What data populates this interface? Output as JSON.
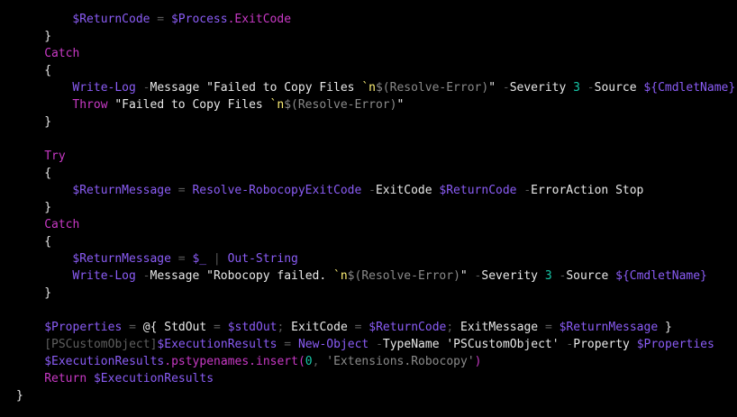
{
  "colors": {
    "background": "#000000",
    "default": "#e8e8e8",
    "variable": "#8a5cf5",
    "keyword": "#c839c5",
    "cmdlet": "#8a5cf5",
    "operator": "#5a5a5a",
    "string": "#e8e8e8",
    "number": "#16c7a8",
    "escape": "#fff176",
    "subexpr": "#8a8a8a",
    "type": "#5f5f5f",
    "member": "#c839c5"
  },
  "lines": [
    {
      "indent": 8,
      "tokens": [
        {
          "t": "var",
          "v": "$ReturnCode"
        },
        {
          "t": "op",
          "v": " = "
        },
        {
          "t": "var",
          "v": "$Process"
        },
        {
          "t": "member",
          "v": ".ExitCode"
        }
      ]
    },
    {
      "indent": 4,
      "tokens": [
        {
          "t": "plain",
          "v": "}"
        }
      ]
    },
    {
      "indent": 4,
      "tokens": [
        {
          "t": "kw",
          "v": "Catch"
        }
      ]
    },
    {
      "indent": 4,
      "tokens": [
        {
          "t": "plain",
          "v": "{"
        }
      ]
    },
    {
      "indent": 8,
      "tokens": [
        {
          "t": "cmd",
          "v": "Write-Log"
        },
        {
          "t": "op",
          "v": " -"
        },
        {
          "t": "plain",
          "v": "Message "
        },
        {
          "t": "str",
          "v": "\"Failed to Copy Files "
        },
        {
          "t": "esc",
          "v": "`n"
        },
        {
          "t": "sub",
          "v": "$(Resolve-Error)"
        },
        {
          "t": "str",
          "v": "\""
        },
        {
          "t": "op",
          "v": " -"
        },
        {
          "t": "plain",
          "v": "Severity "
        },
        {
          "t": "num",
          "v": "3"
        },
        {
          "t": "op",
          "v": " -"
        },
        {
          "t": "plain",
          "v": "Source "
        },
        {
          "t": "var",
          "v": "${CmdletName}"
        }
      ]
    },
    {
      "indent": 8,
      "tokens": [
        {
          "t": "kw",
          "v": "Throw"
        },
        {
          "t": "plain",
          "v": " "
        },
        {
          "t": "str",
          "v": "\"Failed to Copy Files "
        },
        {
          "t": "esc",
          "v": "`n"
        },
        {
          "t": "sub",
          "v": "$(Resolve-Error)"
        },
        {
          "t": "str",
          "v": "\""
        }
      ]
    },
    {
      "indent": 4,
      "tokens": [
        {
          "t": "plain",
          "v": "}"
        }
      ]
    },
    {
      "indent": 0,
      "tokens": []
    },
    {
      "indent": 4,
      "tokens": [
        {
          "t": "kw",
          "v": "Try"
        }
      ]
    },
    {
      "indent": 4,
      "tokens": [
        {
          "t": "plain",
          "v": "{"
        }
      ]
    },
    {
      "indent": 8,
      "tokens": [
        {
          "t": "var",
          "v": "$ReturnMessage"
        },
        {
          "t": "op",
          "v": " = "
        },
        {
          "t": "cmd",
          "v": "Resolve-RobocopyExitCode"
        },
        {
          "t": "op",
          "v": " -"
        },
        {
          "t": "plain",
          "v": "ExitCode "
        },
        {
          "t": "var",
          "v": "$ReturnCode"
        },
        {
          "t": "op",
          "v": " -"
        },
        {
          "t": "plain",
          "v": "ErrorAction Stop"
        }
      ]
    },
    {
      "indent": 4,
      "tokens": [
        {
          "t": "plain",
          "v": "}"
        }
      ]
    },
    {
      "indent": 4,
      "tokens": [
        {
          "t": "kw",
          "v": "Catch"
        }
      ]
    },
    {
      "indent": 4,
      "tokens": [
        {
          "t": "plain",
          "v": "{"
        }
      ]
    },
    {
      "indent": 8,
      "tokens": [
        {
          "t": "var",
          "v": "$ReturnMessage"
        },
        {
          "t": "op",
          "v": " = "
        },
        {
          "t": "var",
          "v": "$_"
        },
        {
          "t": "op",
          "v": " | "
        },
        {
          "t": "cmd",
          "v": "Out-String"
        }
      ]
    },
    {
      "indent": 8,
      "tokens": [
        {
          "t": "cmd",
          "v": "Write-Log"
        },
        {
          "t": "op",
          "v": " -"
        },
        {
          "t": "plain",
          "v": "Message "
        },
        {
          "t": "str",
          "v": "\"Robocopy failed. "
        },
        {
          "t": "esc",
          "v": "`n"
        },
        {
          "t": "sub",
          "v": "$(Resolve-Error)"
        },
        {
          "t": "str",
          "v": "\""
        },
        {
          "t": "op",
          "v": " -"
        },
        {
          "t": "plain",
          "v": "Severity "
        },
        {
          "t": "num",
          "v": "3"
        },
        {
          "t": "op",
          "v": " -"
        },
        {
          "t": "plain",
          "v": "Source "
        },
        {
          "t": "var",
          "v": "${CmdletName}"
        }
      ]
    },
    {
      "indent": 4,
      "tokens": [
        {
          "t": "plain",
          "v": "}"
        }
      ]
    },
    {
      "indent": 0,
      "tokens": []
    },
    {
      "indent": 4,
      "tokens": [
        {
          "t": "var",
          "v": "$Properties"
        },
        {
          "t": "op",
          "v": " = "
        },
        {
          "t": "plain",
          "v": "@{ StdOut "
        },
        {
          "t": "op",
          "v": "= "
        },
        {
          "t": "var",
          "v": "$stdOut"
        },
        {
          "t": "op",
          "v": "; "
        },
        {
          "t": "plain",
          "v": "ExitCode "
        },
        {
          "t": "op",
          "v": "= "
        },
        {
          "t": "var",
          "v": "$ReturnCode"
        },
        {
          "t": "op",
          "v": "; "
        },
        {
          "t": "plain",
          "v": "ExitMessage "
        },
        {
          "t": "op",
          "v": "= "
        },
        {
          "t": "var",
          "v": "$ReturnMessage"
        },
        {
          "t": "plain",
          "v": " }"
        }
      ]
    },
    {
      "indent": 4,
      "tokens": [
        {
          "t": "type",
          "v": "[PSCustomObject]"
        },
        {
          "t": "var",
          "v": "$ExecutionResults"
        },
        {
          "t": "op",
          "v": " = "
        },
        {
          "t": "cmd",
          "v": "New-Object"
        },
        {
          "t": "op",
          "v": " -"
        },
        {
          "t": "plain",
          "v": "TypeName "
        },
        {
          "t": "str",
          "v": "'PSCustomObject'"
        },
        {
          "t": "op",
          "v": " -"
        },
        {
          "t": "plain",
          "v": "Property "
        },
        {
          "t": "var",
          "v": "$Properties"
        }
      ]
    },
    {
      "indent": 4,
      "tokens": [
        {
          "t": "var",
          "v": "$ExecutionResults"
        },
        {
          "t": "member",
          "v": ".pstypenames.insert("
        },
        {
          "t": "num",
          "v": "0"
        },
        {
          "t": "op",
          "v": ", "
        },
        {
          "t": "sub",
          "v": "'Extensions.Robocopy'"
        },
        {
          "t": "member",
          "v": ")"
        }
      ]
    },
    {
      "indent": 4,
      "tokens": [
        {
          "t": "kw",
          "v": "Return"
        },
        {
          "t": "plain",
          "v": " "
        },
        {
          "t": "var",
          "v": "$ExecutionResults"
        }
      ]
    },
    {
      "indent": 0,
      "tokens": [
        {
          "t": "plain",
          "v": "}"
        }
      ]
    }
  ]
}
